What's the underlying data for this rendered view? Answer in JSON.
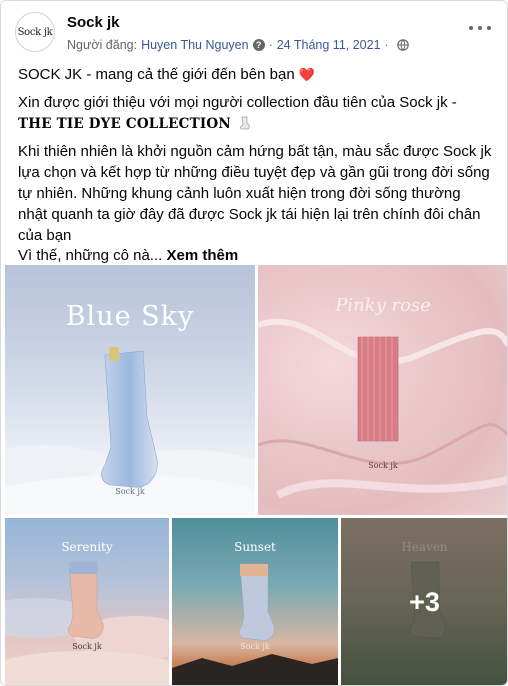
{
  "post": {
    "page_name": "Sock jk",
    "avatar_text": "Sock jk",
    "poster_label": "Người đăng:",
    "poster_name": "Huyen Thu Nguyen",
    "date": "24 Tháng 11, 2021",
    "separator": "·",
    "line1": "SOCK JK - mang cả thế giới đến bên bạn",
    "line2a": "Xin được giới thiệu với mọi người collection đầu tiên của Sock jk -",
    "line2b": "THE TIE DYE COLLECTION",
    "line3": "Khi thiên nhiên là khởi nguồn cảm hứng bất tận, màu sắc được Sock jk lựa chọn và kết hợp từ những điều tuyệt đẹp và gần gũi trong đời sống tự nhiên. Những khung cảnh luôn xuất hiện trong đời sống thường nhật quanh ta giờ đây đã được Sock jk tái hiện lại trên chính đôi chân của bạn",
    "line4": "Vì thế, những cô nà...",
    "see_more": "Xem thêm"
  },
  "icons": {
    "question": "question-icon",
    "globe": "globe-icon",
    "heart": "heart-icon",
    "sock": "sock-icon",
    "more": "more-options-icon"
  },
  "photos": [
    {
      "title": "Blue Sky",
      "brand": "Sock jk"
    },
    {
      "title": "Pinky rose",
      "brand": "Sock jk"
    },
    {
      "title": "Serenity",
      "brand": "Sock jk"
    },
    {
      "title": "Sunset",
      "brand": "Sock jk"
    },
    {
      "title": "Heaven",
      "overlay": "+3"
    }
  ],
  "colors": {
    "link": "#385898",
    "meta": "#65676b",
    "heart": "#e0245e"
  }
}
